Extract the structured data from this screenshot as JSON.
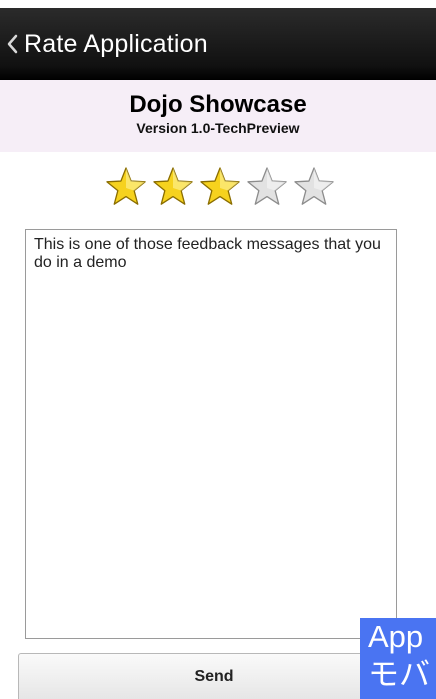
{
  "header": {
    "back_icon": "chevron-left-icon",
    "title": "Rate Application"
  },
  "app": {
    "name": "Dojo Showcase",
    "version": "Version 1.0-TechPreview"
  },
  "rating": {
    "value": 3,
    "max": 5,
    "filled_color": "#f6d21e",
    "empty_color": "#e2e2e2"
  },
  "feedback": {
    "value": "This is one of those feedback messages that you do in a demo"
  },
  "send": {
    "label": "Send"
  },
  "overlay": {
    "line1": "App",
    "line2": "モバ",
    "color": "#4a74f2"
  }
}
